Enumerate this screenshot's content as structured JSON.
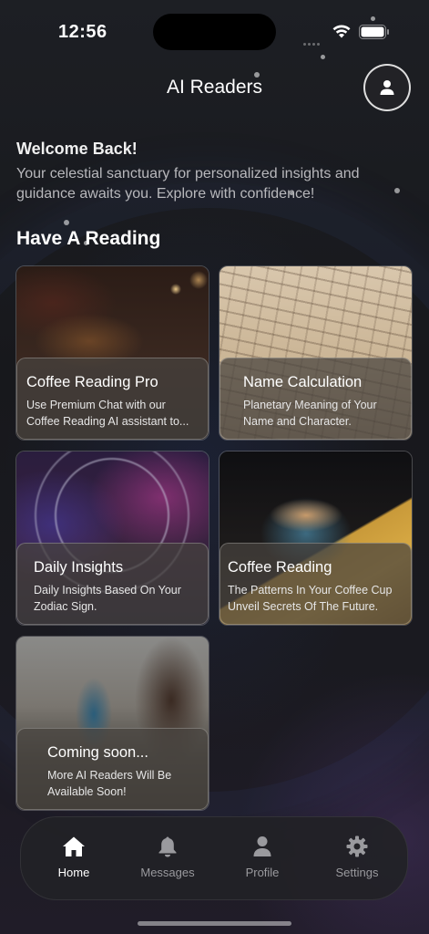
{
  "status_bar": {
    "time": "12:56"
  },
  "header": {
    "title": "AI Readers",
    "profile_icon": "person-icon"
  },
  "welcome": {
    "title": "Welcome Back!",
    "text": "Your celestial sanctuary for personalized insights and guidance awaits you. Explore with confidence!"
  },
  "section": {
    "title": "Have A Reading"
  },
  "cards": [
    {
      "title": "Coffee Reading Pro",
      "description": "Use Premium Chat with our Coffee Reading AI assistant to..."
    },
    {
      "title": "Name Calculation",
      "description": "Planetary Meaning of Your Name and Character."
    },
    {
      "title": "Daily Insights",
      "description": "Daily Insights Based On Your Zodiac Sign."
    },
    {
      "title": "Coffee Reading",
      "description": "The Patterns In Your Coffee Cup Unveil Secrets Of The Future."
    },
    {
      "title": "Coming soon...",
      "description": "More AI Readers Will Be Available Soon!"
    }
  ],
  "tab_bar": {
    "items": [
      {
        "label": "Home",
        "icon": "home-icon",
        "active": true
      },
      {
        "label": "Messages",
        "icon": "bell-icon",
        "active": false
      },
      {
        "label": "Profile",
        "icon": "person-icon",
        "active": false
      },
      {
        "label": "Settings",
        "icon": "gear-icon",
        "active": false
      }
    ]
  }
}
